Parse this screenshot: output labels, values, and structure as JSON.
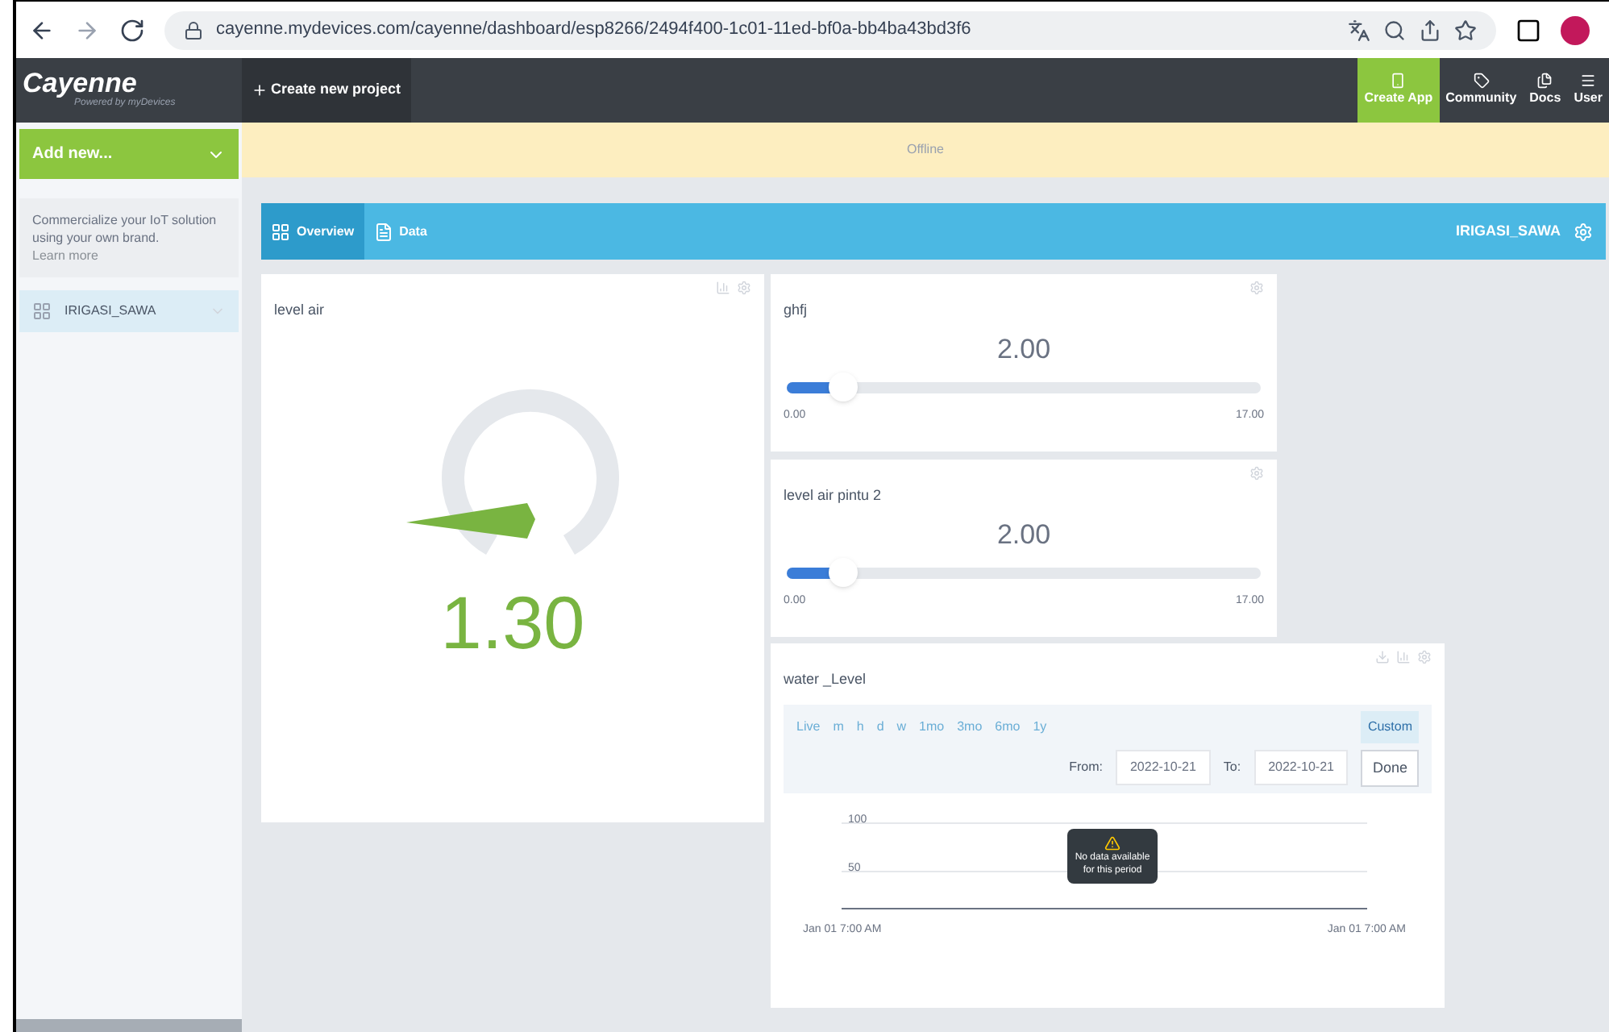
{
  "browser": {
    "url": "cayenne.mydevices.com/cayenne/dashboard/esp8266/2494f400-1c01-11ed-bf0a-bb4ba43bd3f6"
  },
  "header": {
    "logo": "Cayenne",
    "tagline": "Powered by myDevices",
    "create_project": "Create new project",
    "nav": [
      {
        "label": "Create App",
        "selected": true
      },
      {
        "label": "Community",
        "selected": false
      },
      {
        "label": "Docs",
        "selected": false
      },
      {
        "label": "User",
        "selected": false
      }
    ]
  },
  "sidebar": {
    "add_new": "Add new...",
    "promo": "Commercialize your IoT solution using your own brand.",
    "promo_link": "Learn more",
    "devices": [
      {
        "name": "IRIGASI_SAWA",
        "selected": true
      }
    ]
  },
  "status_banner": "Offline",
  "tabs": [
    {
      "label": "Overview",
      "selected": true
    },
    {
      "label": "Data",
      "selected": false
    }
  ],
  "device_title": "IRIGASI_SAWA",
  "gauge": {
    "title": "level air",
    "value": "1.30"
  },
  "sliders": [
    {
      "title": "ghfj",
      "value": "2.00",
      "level": 0.12,
      "min": "0.00",
      "max": "17.00"
    },
    {
      "title": "level air pintu 2",
      "value": "2.00",
      "level": 0.12,
      "min": "0.00",
      "max": "17.00"
    }
  ],
  "chart_widget": {
    "title": "water _Level",
    "ranges": [
      {
        "label": "Live",
        "selected": false
      },
      {
        "label": "m",
        "selected": false
      },
      {
        "label": "h",
        "selected": false
      },
      {
        "label": "d",
        "selected": false
      },
      {
        "label": "w",
        "selected": false
      },
      {
        "label": "1mo",
        "selected": false
      },
      {
        "label": "3mo",
        "selected": false
      },
      {
        "label": "6mo",
        "selected": false
      },
      {
        "label": "1y",
        "selected": false
      }
    ],
    "custom": {
      "label": "Custom",
      "selected": true
    },
    "from_label": "From:",
    "from": "2022-10-21",
    "to_label": "To:",
    "to": "2022-10-21",
    "done": "Done",
    "y_ticks": [
      "100",
      "50"
    ],
    "x_labels": [
      "Jan 01 7:00 AM",
      "Jan 01 7:00 AM"
    ],
    "message": "No data available for this period"
  }
}
